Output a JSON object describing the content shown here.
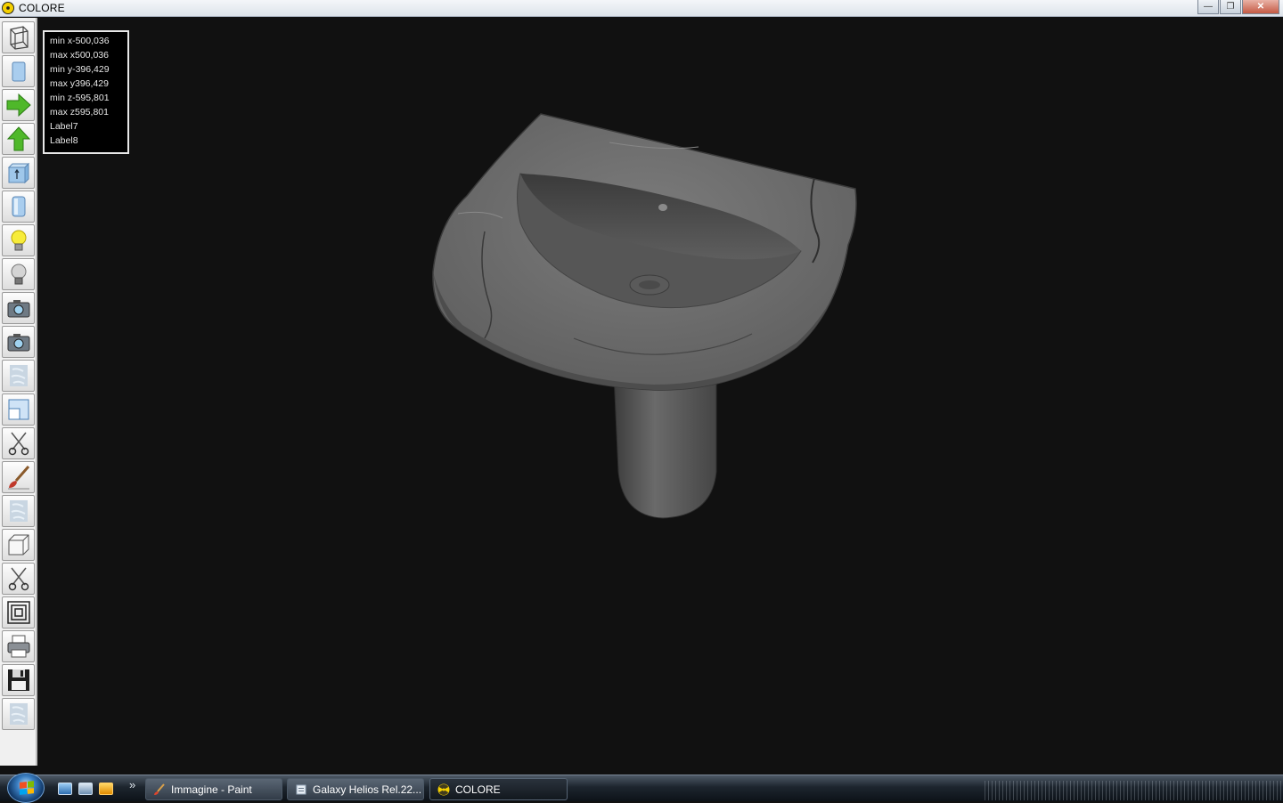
{
  "window": {
    "title": "COLORE",
    "controls": [
      "minimize",
      "maximize",
      "close"
    ]
  },
  "toolbar": {
    "tools": [
      {
        "name": "wireframe-icon"
      },
      {
        "name": "solid-box-icon"
      },
      {
        "name": "arrow-right-icon"
      },
      {
        "name": "arrow-up-icon"
      },
      {
        "name": "box-front-icon"
      },
      {
        "name": "cylinder-icon"
      },
      {
        "name": "bulb-on-icon"
      },
      {
        "name": "bulb-off-icon"
      },
      {
        "name": "camera-icon"
      },
      {
        "name": "camera-2-icon"
      },
      {
        "name": "texture-icon"
      },
      {
        "name": "resize-window-icon"
      },
      {
        "name": "scissors-icon"
      },
      {
        "name": "paint-brush-icon"
      },
      {
        "name": "texture-2-icon"
      },
      {
        "name": "cube-icon"
      },
      {
        "name": "scissors-2-icon"
      },
      {
        "name": "concentric-squares-icon"
      },
      {
        "name": "printer-icon"
      },
      {
        "name": "floppy-disk-icon"
      },
      {
        "name": "texture-3-icon"
      }
    ]
  },
  "info": {
    "min_x": "min x-500,036",
    "max_x": "max x500,036",
    "min_y": "min y-396,429",
    "max_y": "max y396,429",
    "min_z": "min z-595,801",
    "max_z": "max z595,801",
    "label7": "Label7",
    "label8": "Label8"
  },
  "viewport": {
    "object": "washbasin-3d-model",
    "background": "#111111"
  },
  "taskbar": {
    "items": [
      {
        "label": "Immagine - Paint"
      },
      {
        "label": "Galaxy Helios  Rel.22..."
      },
      {
        "label": "COLORE"
      }
    ],
    "quicklaunch_more": "»"
  },
  "colors": {
    "toolbar_bg": "#f0f0f0",
    "viewport_bg": "#111111",
    "info_text": "#e6e6e6",
    "taskbar_bg": "#1d252e"
  }
}
